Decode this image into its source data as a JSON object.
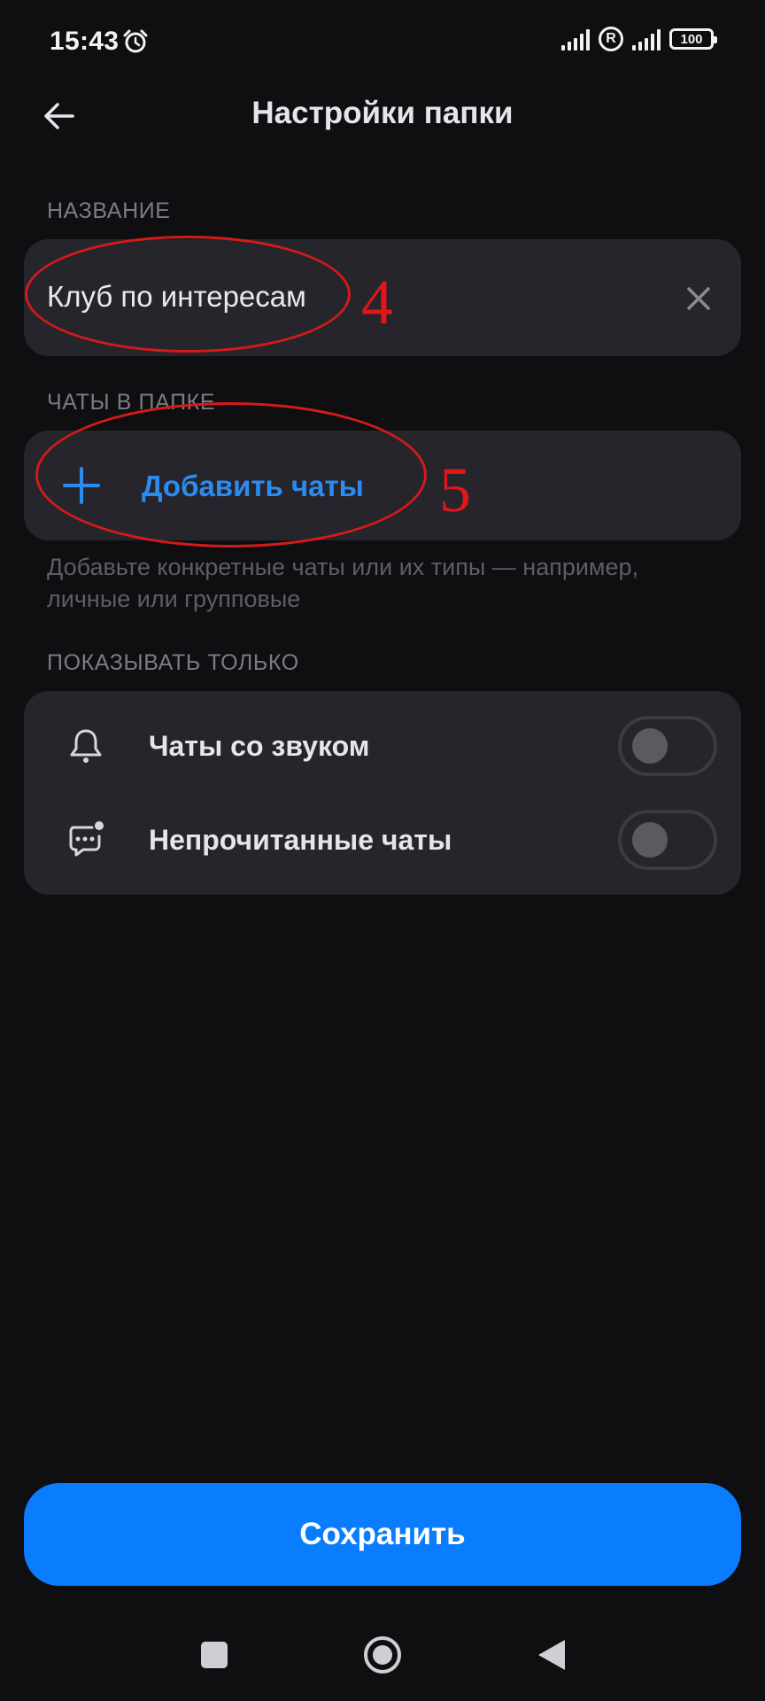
{
  "status_bar": {
    "time": "15:43",
    "alarm_icon": "alarm-clock-icon",
    "roaming": "R",
    "battery": "100"
  },
  "header": {
    "title": "Настройки папки",
    "back_icon": "arrow-left-icon"
  },
  "name_section": {
    "label": "НАЗВАНИЕ",
    "value": "Клуб по интересам",
    "clear_icon": "close-icon"
  },
  "chats_section": {
    "label": "ЧАТЫ В ПАПКЕ",
    "add_label": "Добавить чаты",
    "hint": "Добавьте конкретные чаты или их типы — например, личные или групповые"
  },
  "filter_section": {
    "label": "ПОКАЗЫВАТЬ ТОЛЬКО",
    "items": [
      {
        "label": "Чаты со звуком",
        "icon": "bell-icon",
        "enabled": false
      },
      {
        "label": "Непрочитанные чаты",
        "icon": "unread-chat-icon",
        "enabled": false
      }
    ]
  },
  "save_button": {
    "label": "Сохранить"
  },
  "annotations": [
    {
      "number": "4"
    },
    {
      "number": "5"
    }
  ],
  "colors": {
    "background": "#0f0f12",
    "card": "#25252b",
    "accent": "#0a7dff",
    "link": "#2c8bf0",
    "annotation": "#d41a1a"
  }
}
